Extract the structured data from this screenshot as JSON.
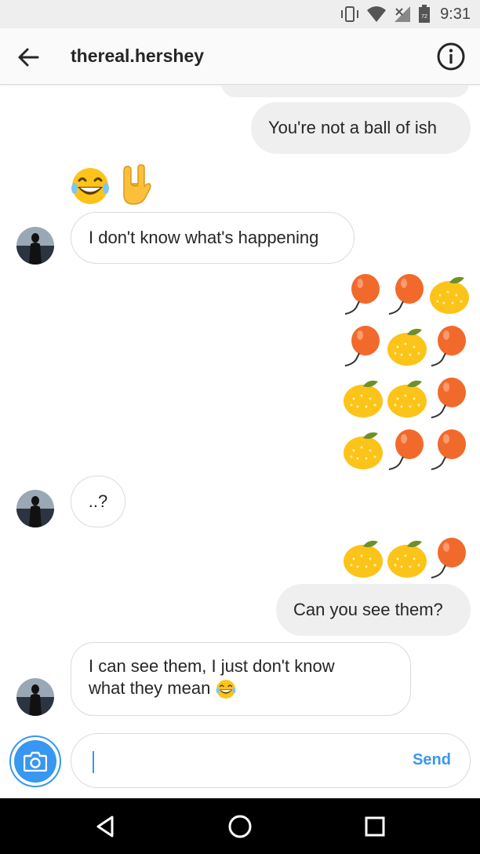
{
  "status_bar": {
    "time": "9:31",
    "battery_level": "72"
  },
  "header": {
    "username": "thereal.hershey",
    "back_icon": "arrow-left-icon",
    "info_icon": "info-icon"
  },
  "messages": [
    {
      "sender": "me",
      "text": "You're not a ball of ish"
    },
    {
      "sender": "them",
      "emojis": [
        "laughing-face-emoji",
        "rock-on-hand-emoji"
      ]
    },
    {
      "sender": "them",
      "text": "I don't know what's happening"
    },
    {
      "sender": "me",
      "emoji_grid": [
        [
          "balloon",
          "balloon",
          "tangerine"
        ],
        [
          "balloon",
          "tangerine",
          "balloon"
        ],
        [
          "tangerine",
          "tangerine",
          "balloon"
        ],
        [
          "tangerine",
          "balloon",
          "balloon"
        ]
      ]
    },
    {
      "sender": "them",
      "text": "..?"
    },
    {
      "sender": "me",
      "emoji_row": [
        "tangerine",
        "tangerine",
        "balloon"
      ]
    },
    {
      "sender": "me",
      "text": "Can you see them?"
    },
    {
      "sender": "them",
      "text_line1": "I can see them, I just don't know",
      "text_line2": "what they mean"
    }
  ],
  "composer": {
    "input_value": "",
    "send_label": "Send",
    "camera_icon": "camera-icon"
  },
  "nav_bar": {
    "back_icon": "triangle-back-icon",
    "home_icon": "circle-home-icon",
    "recents_icon": "square-recents-icon"
  },
  "colors": {
    "accent": "#3897f0",
    "my_bubble": "#efefef",
    "their_border": "#dbdbdb",
    "balloon": "#f16a2c",
    "tangerine": "#fcc419"
  }
}
